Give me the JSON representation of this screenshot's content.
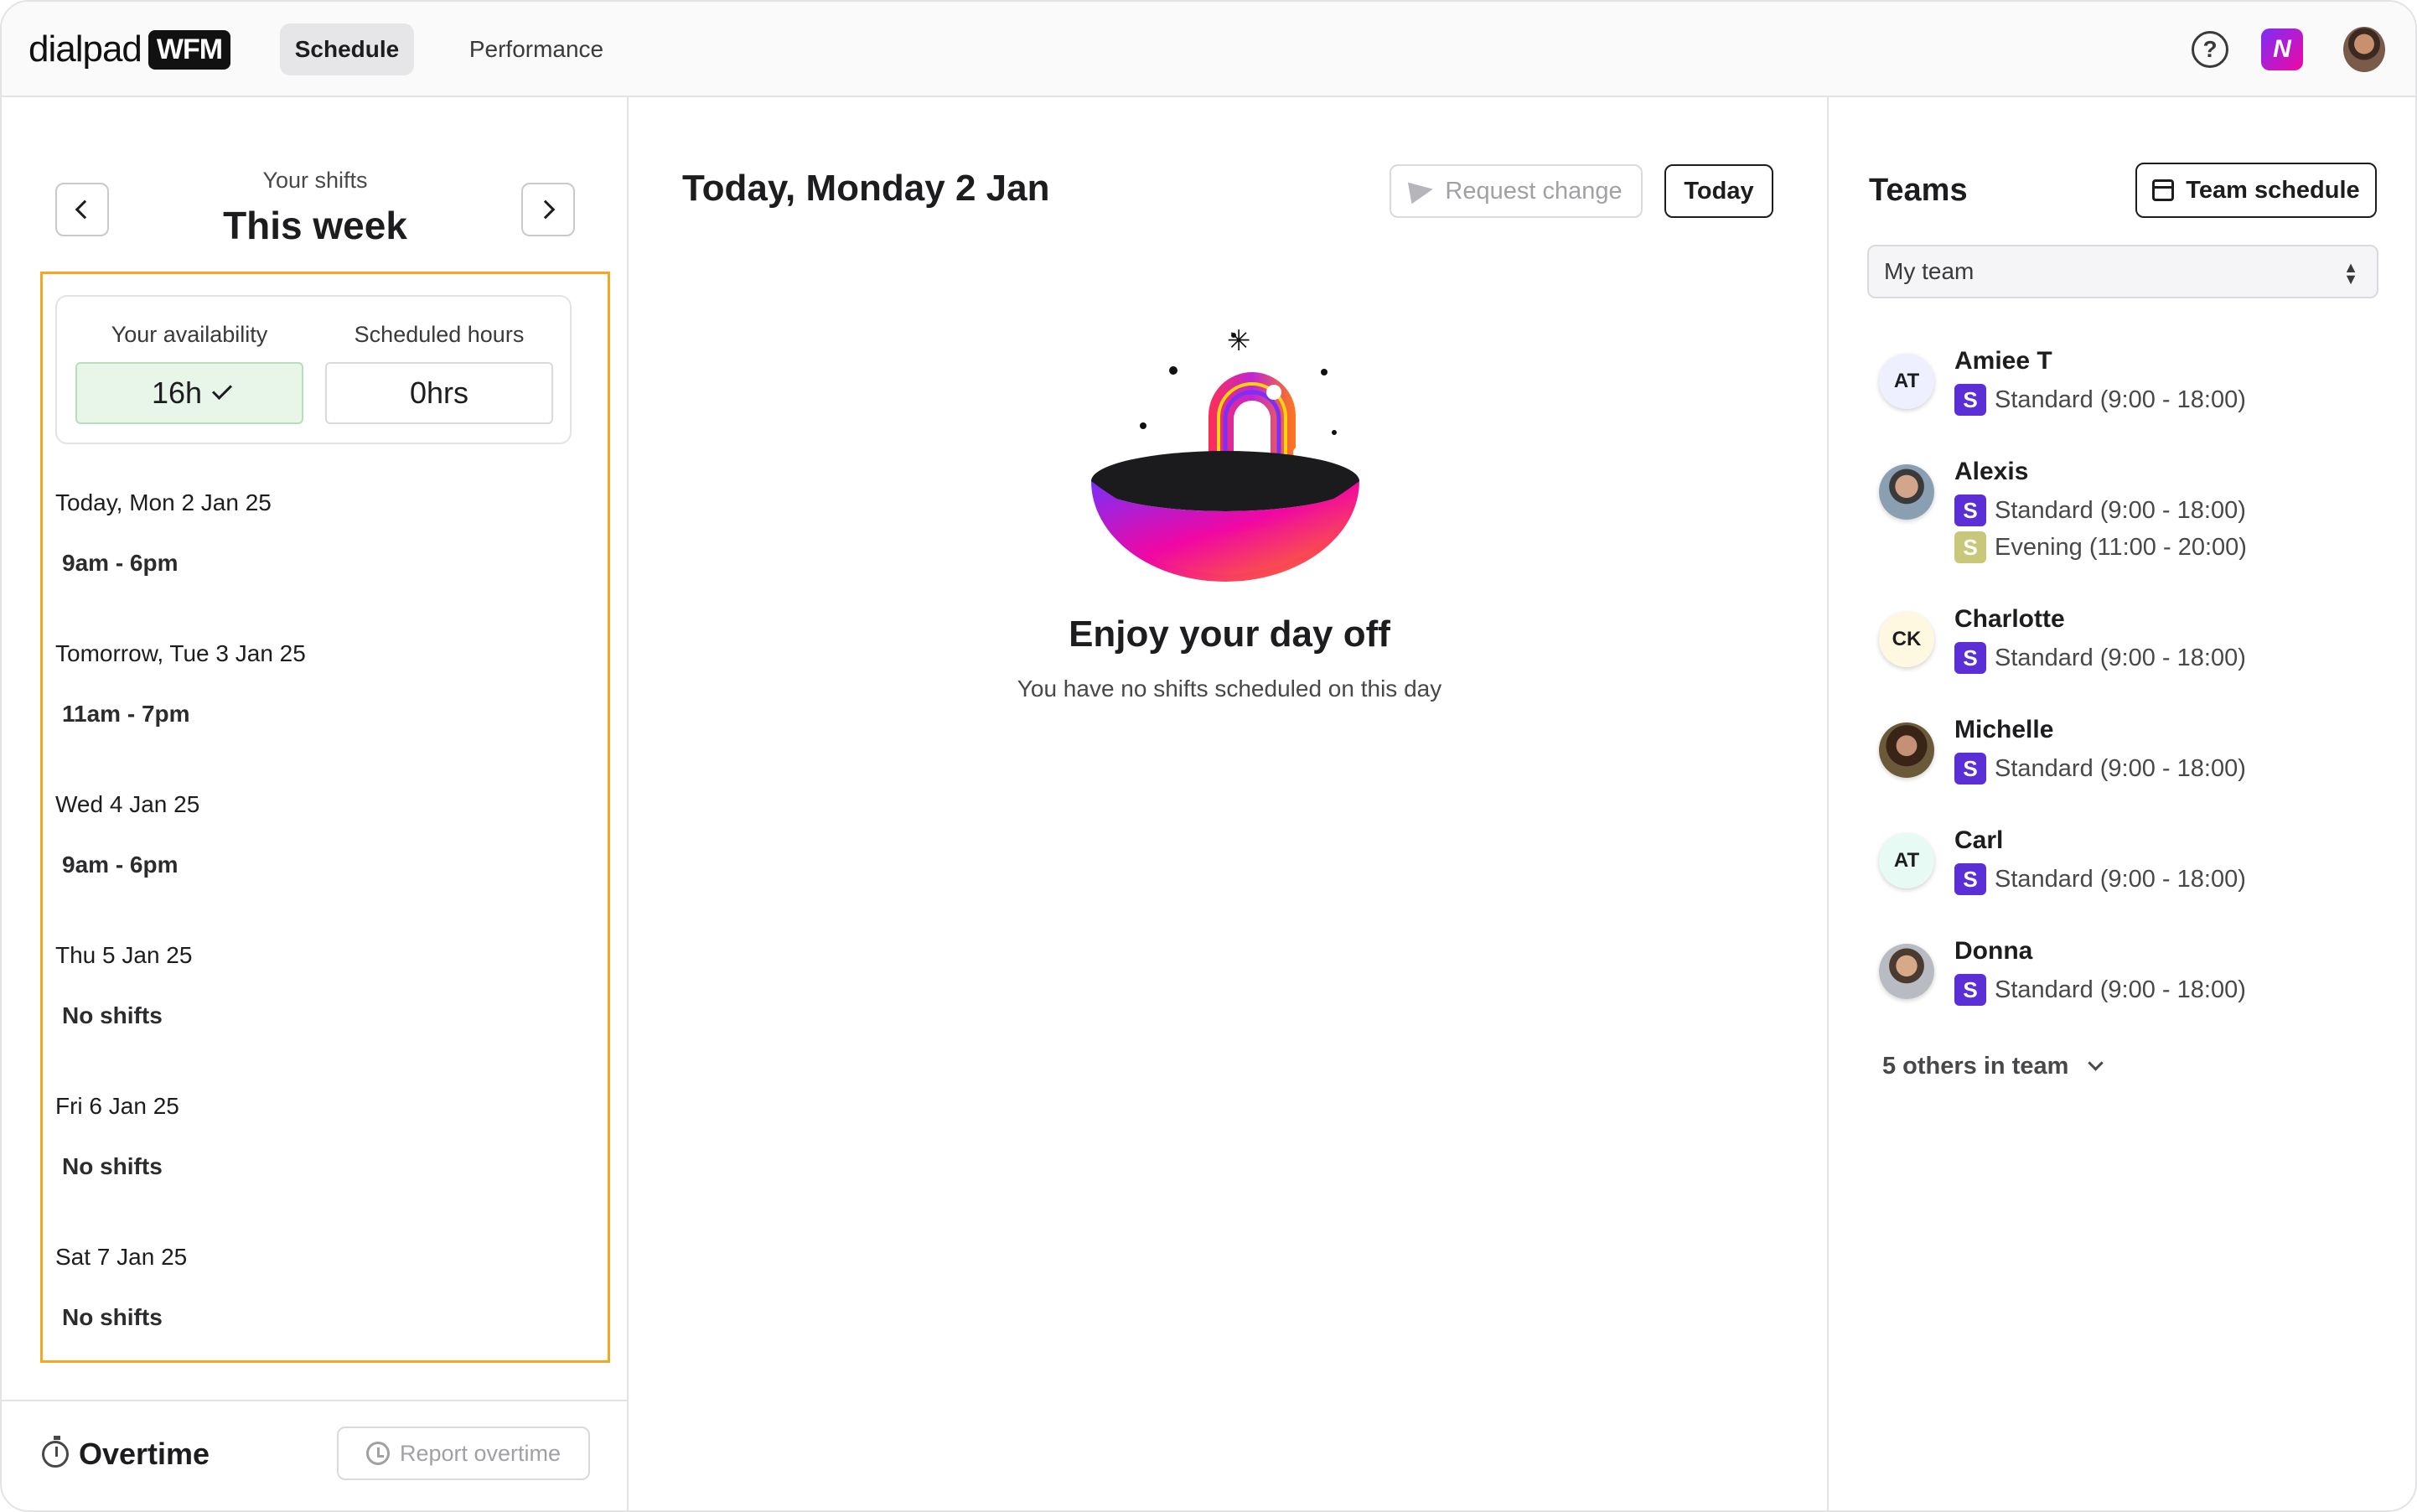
{
  "app": {
    "logo_word": "dialpad",
    "logo_badge": "WFM",
    "nav": {
      "schedule": "Schedule",
      "performance": "Performance"
    },
    "icons": {
      "help": "help-icon",
      "ai": "ai-assistant-icon",
      "avatar": "user-avatar"
    }
  },
  "left": {
    "caption": "Your shifts",
    "period": "This week",
    "availability_label": "Your availability",
    "availability_value": "16h",
    "hours_label": "Scheduled hours",
    "hours_value": "0hrs",
    "days": [
      {
        "label": "Today, Mon 2 Jan 25",
        "shift": "9am - 6pm"
      },
      {
        "label": "Tomorrow, Tue 3 Jan 25",
        "shift": "11am - 7pm"
      },
      {
        "label": "Wed 4 Jan 25",
        "shift": "9am - 6pm"
      },
      {
        "label": "Thu 5 Jan 25",
        "shift": "No shifts"
      },
      {
        "label": "Fri 6 Jan 25",
        "shift": "No shifts"
      },
      {
        "label": "Sat 7 Jan 25",
        "shift": "No shifts"
      }
    ],
    "overtime_title": "Overtime",
    "report_button": "Report overtime"
  },
  "middle": {
    "title": "Today, Monday 2 Jan",
    "request_button": "Request change",
    "today_button": "Today",
    "empty_title": "Enjoy your day off",
    "empty_sub": "You have no shifts scheduled on this day"
  },
  "right": {
    "title": "Teams",
    "schedule_button": "Team schedule",
    "team_select": "My team",
    "members": [
      {
        "name": "Amiee T",
        "initials": "AT",
        "shifts": [
          {
            "badge": "S",
            "text": "Standard (9:00 - 18:00)",
            "color": "#5b2ed6"
          }
        ]
      },
      {
        "name": "Alexis",
        "initials": "",
        "shifts": [
          {
            "badge": "S",
            "text": "Standard (9:00 - 18:00)",
            "color": "#5b2ed6"
          },
          {
            "badge": "S",
            "text": "Evening (11:00 - 20:00)",
            "color": "#c9c77a"
          }
        ]
      },
      {
        "name": "Charlotte",
        "initials": "CK",
        "shifts": [
          {
            "badge": "S",
            "text": "Standard (9:00 - 18:00)",
            "color": "#5b2ed6"
          }
        ]
      },
      {
        "name": "Michelle",
        "initials": "",
        "shifts": [
          {
            "badge": "S",
            "text": "Standard (9:00 - 18:00)",
            "color": "#5b2ed6"
          }
        ]
      },
      {
        "name": "Carl",
        "initials": "AT",
        "shifts": [
          {
            "badge": "S",
            "text": "Standard (9:00 - 18:00)",
            "color": "#5b2ed6"
          }
        ]
      },
      {
        "name": "Donna",
        "initials": "",
        "shifts": [
          {
            "badge": "S",
            "text": "Standard (9:00 - 18:00)",
            "color": "#5b2ed6"
          }
        ]
      }
    ],
    "others": "5 others in team"
  }
}
